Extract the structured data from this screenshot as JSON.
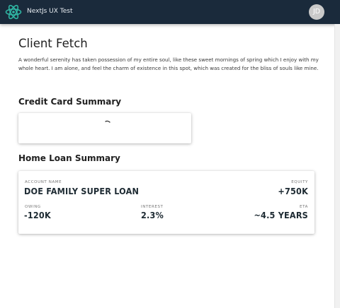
{
  "header": {
    "app_title": "NextJs UX Test",
    "avatar_initials": "JD",
    "logo_icon": "atom-logo-icon",
    "colors": {
      "bar": "#1a2a3b",
      "logo": "#2fb5a3",
      "avatar": "#c9c9c9"
    }
  },
  "page": {
    "title": "Client Fetch",
    "intro": "A wonderful serenity has taken possession of my entire soul, like these sweet mornings of spring which I enjoy with my whole heart. I am alone, and feel the charm of existence in this spot, which was created for the bliss of souls like mine."
  },
  "credit_card": {
    "title": "Credit Card Summary",
    "loading_icon": "spinner-icon"
  },
  "home_loan": {
    "title": "Home Loan Summary",
    "account_name_label": "ACCOUNT NAME",
    "account_name": "DOE FAMILY SUPER LOAN",
    "equity_label": "EQUITY",
    "equity": "+750K",
    "owing_label": "OWING",
    "owing": "-120K",
    "interest_label": "INTEREST",
    "interest": "2.3%",
    "eta_label": "ETA",
    "eta": "~4.5 YEARS"
  }
}
